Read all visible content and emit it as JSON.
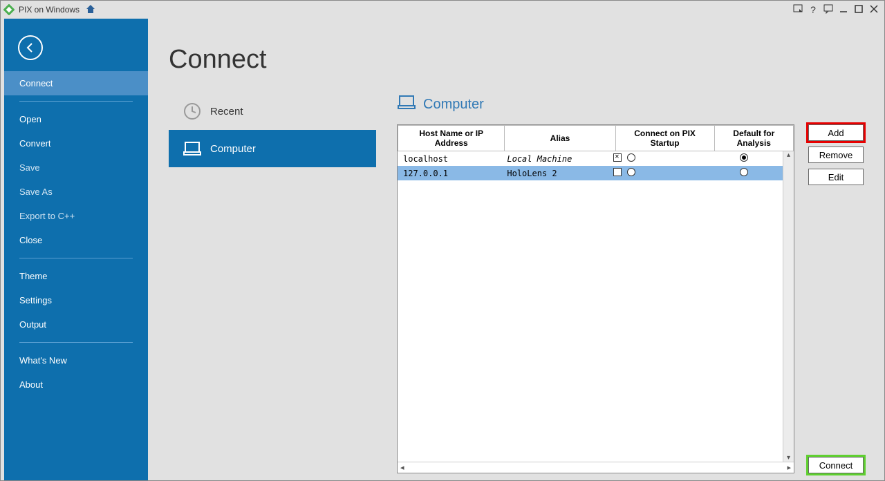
{
  "titlebar": {
    "app_name": "PIX on Windows"
  },
  "sidebar": {
    "items": [
      {
        "label": "Connect",
        "selected": true,
        "dim": false
      },
      {
        "label": "Open",
        "selected": false,
        "dim": false
      },
      {
        "label": "Convert",
        "selected": false,
        "dim": false
      },
      {
        "label": "Save",
        "selected": false,
        "dim": true
      },
      {
        "label": "Save As",
        "selected": false,
        "dim": true
      },
      {
        "label": "Export to C++",
        "selected": false,
        "dim": true
      },
      {
        "label": "Close",
        "selected": false,
        "dim": false
      },
      {
        "label": "Theme",
        "selected": false,
        "dim": false
      },
      {
        "label": "Settings",
        "selected": false,
        "dim": false
      },
      {
        "label": "Output",
        "selected": false,
        "dim": false
      },
      {
        "label": "What's New",
        "selected": false,
        "dim": false
      },
      {
        "label": "About",
        "selected": false,
        "dim": false
      }
    ]
  },
  "page": {
    "title": "Connect"
  },
  "left_list": {
    "recent": "Recent",
    "computer": "Computer"
  },
  "section": {
    "title": "Computer"
  },
  "table": {
    "headers": {
      "host": "Host Name or IP Address",
      "alias": "Alias",
      "startup": "Connect on PIX Startup",
      "default": "Default for Analysis"
    },
    "rows": [
      {
        "host": "localhost",
        "alias": "Local Machine",
        "alias_italic": true,
        "startup_checked": true,
        "startup_radio": false,
        "default_radio": true,
        "selected": false
      },
      {
        "host": "127.0.0.1",
        "alias": "HoloLens 2",
        "alias_italic": false,
        "startup_checked": false,
        "startup_radio": false,
        "default_radio": false,
        "selected": true
      }
    ]
  },
  "buttons": {
    "add": "Add",
    "remove": "Remove",
    "edit": "Edit",
    "connect": "Connect"
  }
}
